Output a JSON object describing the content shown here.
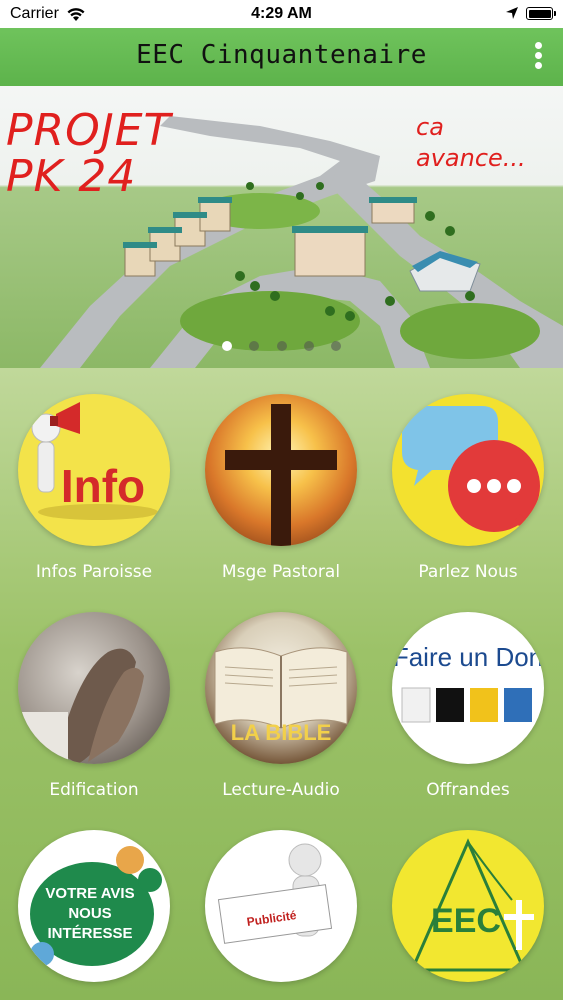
{
  "status_bar": {
    "carrier": "Carrier",
    "time": "4:29 AM"
  },
  "header": {
    "title": "EEC Cinquantenaire"
  },
  "banner": {
    "title_line1": "PROJET",
    "title_line2": "PK 24",
    "note_line1": "ca",
    "note_line2": "avance...",
    "page_count": 5,
    "active_page": 1
  },
  "tiles": [
    {
      "label": "Infos Paroisse",
      "image_text": "Info"
    },
    {
      "label": "Msge Pastoral"
    },
    {
      "label": "Parlez Nous"
    },
    {
      "label": "Edification"
    },
    {
      "label": "Lecture-Audio",
      "image_text": "LA BIBLE"
    },
    {
      "label": "Offrandes",
      "image_text": "Faire un Don"
    },
    {
      "label": "",
      "image_text_1": "VOTRE AVIS",
      "image_text_2": "NOUS",
      "image_text_3": "INTÉRESSE"
    },
    {
      "label": "",
      "image_text": "Publicité"
    },
    {
      "label": "",
      "image_text": "EEC"
    }
  ],
  "colors": {
    "header_green": "#5db34b",
    "tile_label": "#ffffff",
    "banner_red": "#e0201e"
  }
}
